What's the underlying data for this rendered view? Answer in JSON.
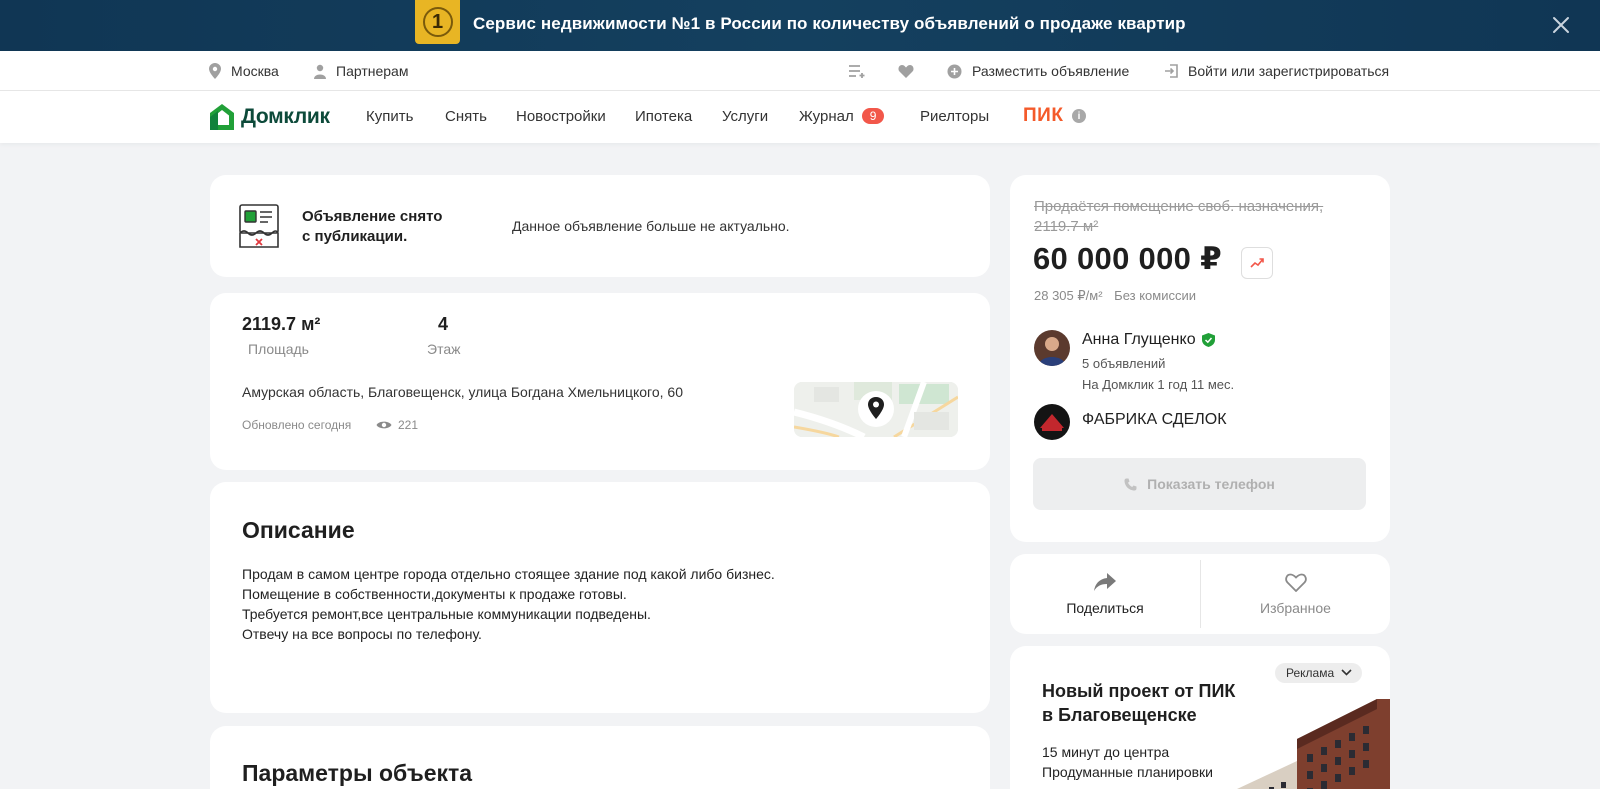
{
  "banner": {
    "badge_number": "1",
    "text": "Сервис недвижимости №1 в России по количеству объявлений о продаже квартир",
    "close_icon": "close-icon"
  },
  "utility": {
    "city": "Москва",
    "partners": "Партнерам",
    "post_ad": "Разместить объявление",
    "login": "Войти или зарегистрироваться"
  },
  "nav": {
    "logo_text": "Домклик",
    "items": [
      "Купить",
      "Снять",
      "Новостройки",
      "Ипотека",
      "Услуги",
      "Журнал",
      "Риелторы"
    ],
    "journal_badge": "9",
    "pik": "ПИК"
  },
  "status_card": {
    "title_line1": "Объявление снято",
    "title_line2": "с публикации.",
    "message": "Данное объявление больше не актуально."
  },
  "info_card": {
    "area_value": "2119.7 м²",
    "area_label": "Площадь",
    "floor_value": "4",
    "floor_label": "Этаж",
    "address": "Амурская область, Благовещенск, улица Богдана Хмельницкого, 60",
    "updated": "Обновлено сегодня",
    "views": "221"
  },
  "description": {
    "heading": "Описание",
    "lines": [
      "Продам в самом центре города отдельно стоящее здание под какой либо бизнес.",
      "Помещение в собственности,документы к продаже готовы.",
      "Требуется ремонт,все центральные коммуникации подведены.",
      "Отвечу на все вопросы по телефону."
    ]
  },
  "params": {
    "heading": "Параметры объекта"
  },
  "price_card": {
    "old_title_line1": "Продаётся помещение своб. назначения,",
    "old_title_line2": "2119.7 м²",
    "price": "60 000 000 ₽",
    "price_per_m": "28 305 ₽/м²",
    "commission": "Без комиссии",
    "agent_name": "Анна Глущенко",
    "agent_ads": "5 объявлений",
    "agent_since": "На Домклик 1 год 11 мес.",
    "agency": "ФАБРИКА СДЕЛОК",
    "show_phone": "Показать телефон"
  },
  "actions": {
    "share": "Поделиться",
    "favorite": "Избранное"
  },
  "ad": {
    "label": "Реклама",
    "title_line1": "Новый проект от ПИК",
    "title_line2": "в Благовещенске",
    "line1": "15 минут до центра",
    "line2": "Продуманные планировки"
  },
  "colors": {
    "banner_bg": "#103654",
    "accent_green": "#21a038",
    "pik_orange": "#f45a2a",
    "badge_red": "#f2574a"
  }
}
